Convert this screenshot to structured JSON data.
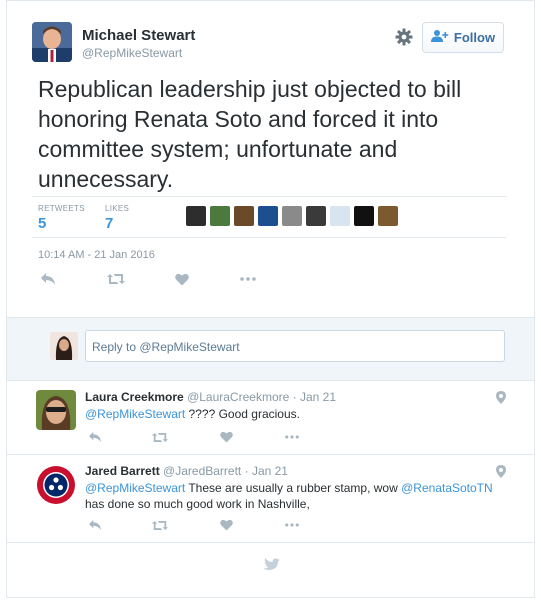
{
  "tweet": {
    "author_name": "Michael Stewart",
    "author_handle": "@RepMikeStewart",
    "follow_label": "Follow",
    "text": "Republican leadership just objected to bill honoring Renata Soto and forced it into committee system; unfortunate and unnecessary.",
    "retweets_label": "RETWEETS",
    "retweets_count": "5",
    "likes_label": "LIKES",
    "likes_count": "7",
    "timestamp": "10:14 AM - 21 Jan 2016"
  },
  "reply_box": {
    "placeholder": "Reply to @RepMikeStewart"
  },
  "replies": [
    {
      "name": "Laura Creekmore",
      "handle": "@LauraCreekmore",
      "date": "· Jan 21",
      "mention": "@RepMikeStewart",
      "text": " ???? Good gracious."
    },
    {
      "name": "Jared Barrett",
      "handle": "@JaredBarrett",
      "date": "· Jan 21",
      "mention": "@RepMikeStewart",
      "text_part1": " These are usually a rubber stamp, wow ",
      "mention2": "@RenataSotoTN",
      "text_part2": " has done so much good work in Nashville,"
    }
  ],
  "icons": {
    "settings": "gear-icon",
    "follow": "add-user-icon",
    "reply": "reply-icon",
    "retweet": "retweet-icon",
    "like": "heart-icon",
    "more": "more-icon",
    "location": "location-pin-icon",
    "brand": "twitter-bird-icon"
  },
  "colors": {
    "accent": "#3b94d9",
    "muted": "#8899a6",
    "text": "#292f33",
    "border": "#e1e8ed",
    "reply_bg": "#eff5f9"
  }
}
